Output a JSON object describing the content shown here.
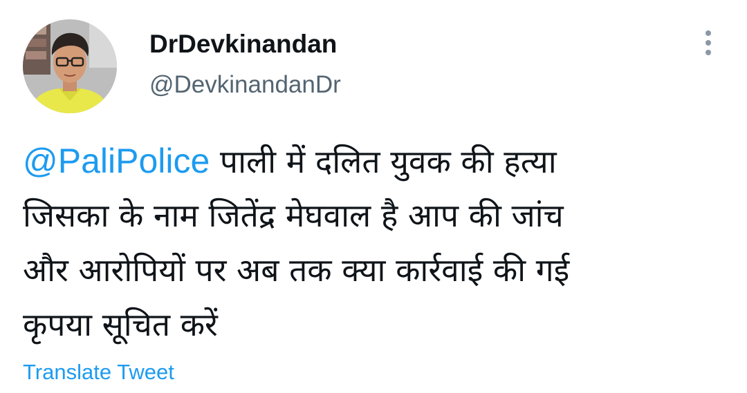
{
  "tweet": {
    "author": {
      "display_name": "DrDevkinandan",
      "handle": "@DevkinandanDr",
      "avatar_icon": "profile-photo"
    },
    "more_icon": "more-vertical-icon",
    "text": {
      "mention": "@PaliPolice",
      "line1_rest": " पाली में दलित युवक की हत्या",
      "line2": "जिसका के नाम जितेंद्र मेघवाल है आप की जांच",
      "line3": "और आरोपियों पर अब तक क्या कार्रवाई की गई",
      "line4": "कृपया सूचित करें"
    },
    "translate_label": "Translate Tweet"
  },
  "colors": {
    "link": "#1d9bf0",
    "text_primary": "#0f1419",
    "text_secondary": "#536471",
    "icon_muted": "#8b98a5",
    "background": "#ffffff"
  }
}
